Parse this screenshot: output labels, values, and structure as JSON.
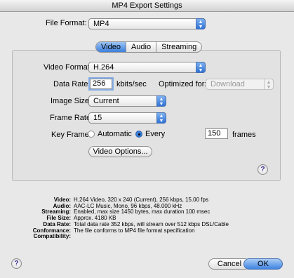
{
  "window": {
    "title": "MP4 Export Settings"
  },
  "file_format": {
    "label": "File Format:",
    "value": "MP4"
  },
  "tabs": [
    {
      "label": "Video",
      "selected": true
    },
    {
      "label": "Audio",
      "selected": false
    },
    {
      "label": "Streaming",
      "selected": false
    }
  ],
  "video": {
    "format_label": "Video Format:",
    "format_value": "H.264",
    "data_rate_label": "Data Rate:",
    "data_rate_value": "256",
    "data_rate_unit": "kbits/sec",
    "optimized_label": "Optimized for:",
    "optimized_value": "Download",
    "image_size_label": "Image Size:",
    "image_size_value": "Current",
    "frame_rate_label": "Frame Rate:",
    "frame_rate_value": "15",
    "key_frame_label": "Key Frame:",
    "automatic_label": "Automatic",
    "every_label": "Every",
    "key_frame_value": "150",
    "frames_label": "frames",
    "options_button": "Video Options..."
  },
  "summary": [
    {
      "key": "Video:",
      "value": "H.264 Video, 320 x 240 (Current), 256 kbps, 15.00 fps"
    },
    {
      "key": "Audio:",
      "value": "AAC-LC Music, Mono, 96 kbps, 48.000 kHz"
    },
    {
      "key": "Streaming:",
      "value": "Enabled, max size 1450 bytes, max duration 100 msec"
    },
    {
      "key": "File Size:",
      "value": "Approx. 4180 KB"
    },
    {
      "key": "Data Rate:",
      "value": "Total data rate 352 kbps, will stream over 512 kbps DSL/Cable"
    },
    {
      "key": "Conformance:",
      "value": "The file conforms to MP4 file format specification"
    },
    {
      "key": "Compatibility:",
      "value": ""
    }
  ],
  "buttons": {
    "cancel": "Cancel",
    "ok": "OK"
  },
  "help_glyph": "?"
}
